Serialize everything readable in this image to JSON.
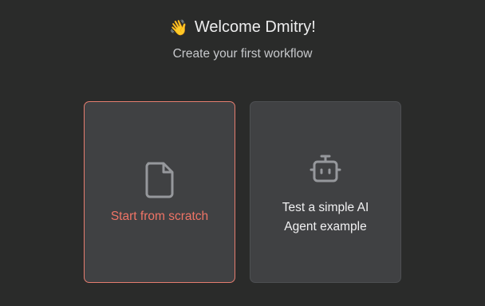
{
  "header": {
    "wave_glyph": "👋",
    "title": "Welcome Dmitry!",
    "subtitle": "Create your first workflow"
  },
  "cards": {
    "scratch": {
      "icon": "file-icon",
      "label": "Start from scratch",
      "accent_color": "#ef7466"
    },
    "agent": {
      "icon": "robot-icon",
      "label_line1": "Test a simple AI",
      "label_line2": "Agent example"
    }
  },
  "colors": {
    "background": "#2a2b2a",
    "card_background": "#404143",
    "icon_gray": "#96989c"
  }
}
